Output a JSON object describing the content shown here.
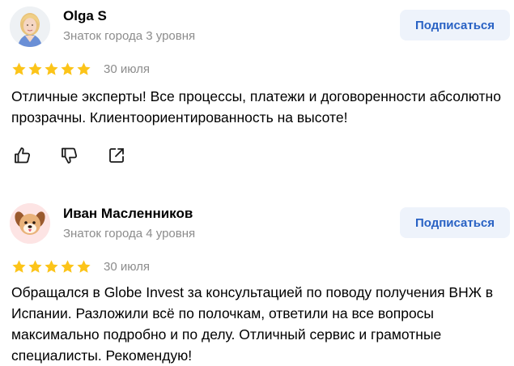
{
  "reviews": [
    {
      "author": "Olga S",
      "level": "Знаток города 3 уровня",
      "subscribe_label": "Подписаться",
      "rating": 5,
      "date": "30 июля",
      "text": "Отличные эксперты! Все процессы, платежи и договоренности абсолютно прозрачны. Клиентоориентированность на высоте!",
      "avatar": "woman-photo",
      "actions": [
        "like-icon",
        "dislike-icon",
        "share-icon"
      ]
    },
    {
      "author": "Иван Масленников",
      "level": "Знаток города 4 уровня",
      "subscribe_label": "Подписаться",
      "rating": 5,
      "date": "30 июля",
      "text": "Обращался в Globe Invest за консультацией по поводу получения ВНЖ в Испании. Разложили всё по полочкам, ответили на все вопросы максимально подробно и по делу. Отличный сервис и грамотные специалисты. Рекомендую!",
      "avatar": "dog-emoji"
    }
  ],
  "colors": {
    "star": "#fcc419",
    "accent": "#2962c4",
    "button_bg": "#eef3fb",
    "muted": "#8c8c8c"
  }
}
